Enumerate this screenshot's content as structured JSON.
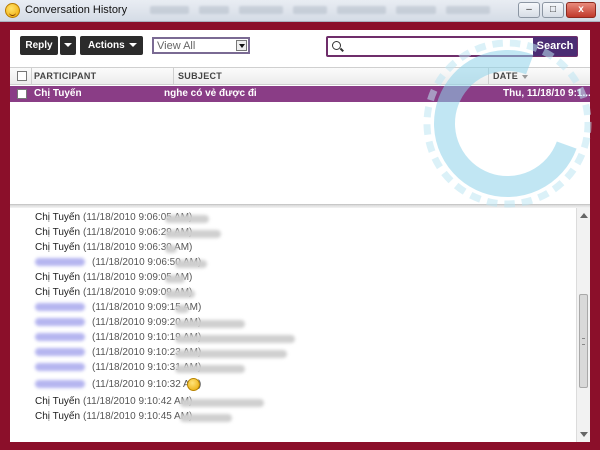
{
  "window": {
    "title": "Conversation History",
    "controls": {
      "minimize": "–",
      "maximize": "□",
      "close": "x"
    }
  },
  "toolbar": {
    "reply_label": "Reply",
    "actions_label": "Actions",
    "view_select_value": "View All",
    "search_placeholder": "",
    "search_label": "Search"
  },
  "list": {
    "columns": {
      "participant": "PARTICIPANT",
      "subject": "SUBJECT",
      "date": "DATE"
    },
    "selected_row": {
      "participant": "Chị Tuyến",
      "subject": "nghe có vẻ được đi",
      "date": "Thu, 11/18/10 9:1..."
    }
  },
  "messages": [
    {
      "sender": "Chị Tuyến",
      "time": "(11/18/2010 9:06:05 AM)"
    },
    {
      "sender": "Chị Tuyến",
      "time": "(11/18/2010 9:06:29 AM)"
    },
    {
      "sender": "Chị Tuyến",
      "time": "(11/18/2010 9:06:30 AM)"
    },
    {
      "sender": "",
      "time": "(11/18/2010 9:06:50 AM)"
    },
    {
      "sender": "Chị Tuyến",
      "time": "(11/18/2010 9:09:05 AM)"
    },
    {
      "sender": "Chị Tuyến",
      "time": "(11/18/2010 9:09:09 AM)"
    },
    {
      "sender": "",
      "time": "(11/18/2010 9:09:15 AM)"
    },
    {
      "sender": "",
      "time": "(11/18/2010 9:09:20 AM)"
    },
    {
      "sender": "",
      "time": "(11/18/2010 9:10:19 AM)"
    },
    {
      "sender": "",
      "time": "(11/18/2010 9:10:23 AM)"
    },
    {
      "sender": "",
      "time": "(11/18/2010 9:10:31 AM)"
    },
    {
      "sender": "",
      "time": "(11/18/2010 9:10:32 AM)"
    },
    {
      "sender": "Chị Tuyến",
      "time": "(11/18/2010 9:10:42 AM)"
    },
    {
      "sender": "Chị Tuyến",
      "time": "(11/18/2010 9:10:45 AM)"
    }
  ],
  "colors": {
    "frame": "#8b0f2a",
    "selected_row": "#8a3d86",
    "search_button": "#4b2c73",
    "toolbar_button": "#2b2b2b"
  },
  "icons": [
    "app-smiley-icon",
    "search-icon",
    "chevron-down-icon",
    "sort-desc-icon",
    "emoji-icon"
  ]
}
